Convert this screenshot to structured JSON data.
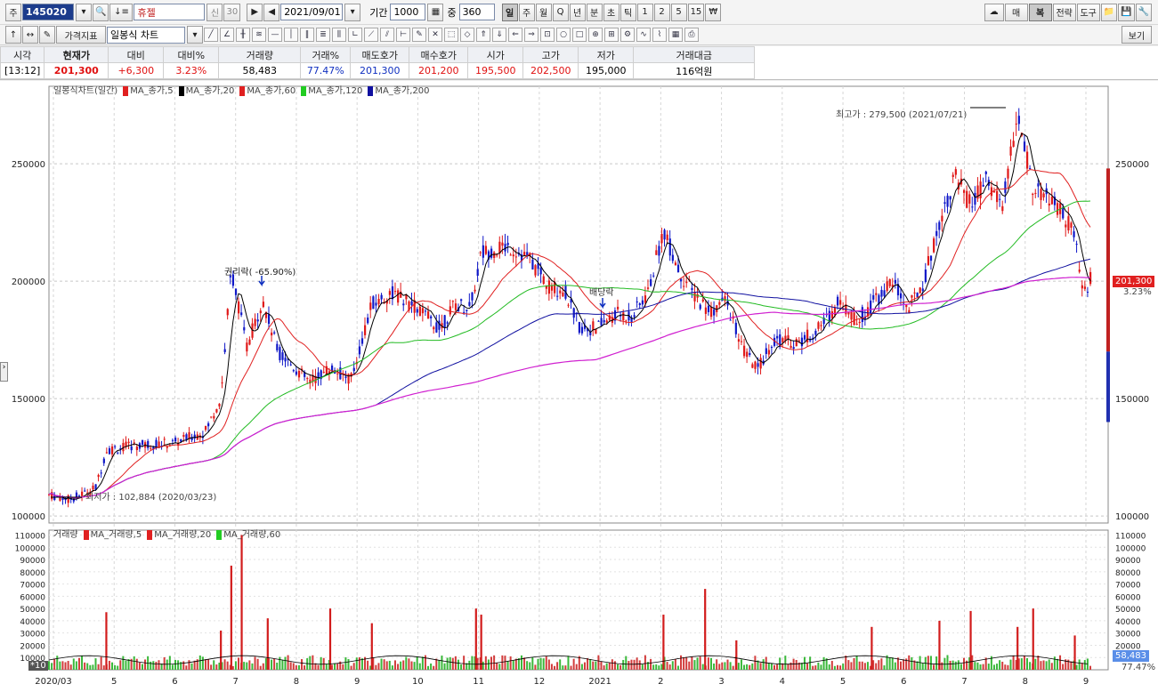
{
  "toolbar1": {
    "market_label": "주",
    "code": "145020",
    "name": "휴젤",
    "credit_tag": "신",
    "credit_value": "30",
    "date": "2021/09/01",
    "period_label": "기간",
    "period_value": "1000",
    "overlap_label": "중",
    "overlap_value": "360",
    "timeframes": [
      "일",
      "주",
      "월",
      "Q",
      "년",
      "분",
      "초",
      "틱",
      "1",
      "2",
      "5",
      "15",
      "₩"
    ],
    "active_timeframe": "일",
    "right_buttons": [
      "매",
      "복",
      "전략",
      "도구"
    ]
  },
  "toolbar2": {
    "indicator_label": "가격지표",
    "chart_type": "일봉식 차트",
    "view_button": "보기"
  },
  "quote": {
    "headers": [
      "시각",
      "현재가",
      "대비",
      "대비%",
      "거래량",
      "거래%",
      "매도호가",
      "매수호가",
      "시가",
      "고가",
      "저가",
      "거래대금"
    ],
    "values": [
      "[13:12]",
      "201,300",
      "+6,300",
      "3.23%",
      "58,483",
      "77.47%",
      "201,300",
      "201,200",
      "195,500",
      "202,500",
      "195,000",
      "116억원"
    ]
  },
  "legend_price": {
    "title": "일봉식차트(일간)",
    "items": [
      {
        "label": "MA_종가,5",
        "color": "#e02020"
      },
      {
        "label": "MA_종가,20",
        "color": "#000000"
      },
      {
        "label": "MA_종가,60",
        "color": "#e02020"
      },
      {
        "label": "MA_종가,120",
        "color": "#22cc22"
      },
      {
        "label": "MA_종가,200",
        "color": "#1010a0"
      }
    ]
  },
  "legend_volume": {
    "title": "거래량",
    "items": [
      {
        "label": "MA_거래량,5",
        "color": "#e02020"
      },
      {
        "label": "MA_거래량,20",
        "color": "#e02020"
      },
      {
        "label": "MA_거래량,60",
        "color": "#22cc22"
      }
    ]
  },
  "annotations": {
    "high": "최고가 : 279,500 (2021/07/21)",
    "low": "최저가 : 102,884 (2020/03/23)",
    "rights": "권리락( -65.90%)",
    "dividend": "배당락"
  },
  "price_badge": {
    "price": "201,300",
    "pct": "3.23%"
  },
  "volume_badge": {
    "volume": "58,483",
    "pct": "77.47%"
  },
  "volume_scale_tag": "*10",
  "chart_data": {
    "type": "candlestick",
    "price_ylim": [
      97000,
      283000
    ],
    "price_ticks": [
      100000,
      150000,
      200000,
      250000
    ],
    "volume_ylim": [
      0,
      114000
    ],
    "volume_ticks": [
      10000,
      20000,
      30000,
      40000,
      50000,
      60000,
      70000,
      80000,
      90000,
      100000,
      110000
    ],
    "x_ticks": [
      "2020/03",
      "5",
      "6",
      "7",
      "8",
      "9",
      "10",
      "11",
      "12",
      "2021",
      "2",
      "3",
      "4",
      "5",
      "6",
      "7",
      "8",
      "9"
    ],
    "anchors": [
      {
        "t": 0.0,
        "p": 109000
      },
      {
        "t": 0.02,
        "p": 107000
      },
      {
        "t": 0.045,
        "p": 112000
      },
      {
        "t": 0.055,
        "p": 128000
      },
      {
        "t": 0.08,
        "p": 130000
      },
      {
        "t": 0.12,
        "p": 131000
      },
      {
        "t": 0.15,
        "p": 136000
      },
      {
        "t": 0.165,
        "p": 150000
      },
      {
        "t": 0.175,
        "p": 205000
      },
      {
        "t": 0.19,
        "p": 172000
      },
      {
        "t": 0.205,
        "p": 192000
      },
      {
        "t": 0.22,
        "p": 170000
      },
      {
        "t": 0.25,
        "p": 157000
      },
      {
        "t": 0.27,
        "p": 163000
      },
      {
        "t": 0.29,
        "p": 158000
      },
      {
        "t": 0.31,
        "p": 190000
      },
      {
        "t": 0.33,
        "p": 195000
      },
      {
        "t": 0.355,
        "p": 188000
      },
      {
        "t": 0.375,
        "p": 180000
      },
      {
        "t": 0.39,
        "p": 190000
      },
      {
        "t": 0.405,
        "p": 189000
      },
      {
        "t": 0.415,
        "p": 212000
      },
      {
        "t": 0.44,
        "p": 215000
      },
      {
        "t": 0.46,
        "p": 210000
      },
      {
        "t": 0.48,
        "p": 198000
      },
      {
        "t": 0.495,
        "p": 196000
      },
      {
        "t": 0.51,
        "p": 180000
      },
      {
        "t": 0.525,
        "p": 180000
      },
      {
        "t": 0.545,
        "p": 186000
      },
      {
        "t": 0.56,
        "p": 185000
      },
      {
        "t": 0.575,
        "p": 195000
      },
      {
        "t": 0.59,
        "p": 222000
      },
      {
        "t": 0.605,
        "p": 204000
      },
      {
        "t": 0.62,
        "p": 194000
      },
      {
        "t": 0.635,
        "p": 187000
      },
      {
        "t": 0.65,
        "p": 192000
      },
      {
        "t": 0.665,
        "p": 172000
      },
      {
        "t": 0.68,
        "p": 162000
      },
      {
        "t": 0.695,
        "p": 175000
      },
      {
        "t": 0.72,
        "p": 174000
      },
      {
        "t": 0.74,
        "p": 180000
      },
      {
        "t": 0.76,
        "p": 192000
      },
      {
        "t": 0.775,
        "p": 183000
      },
      {
        "t": 0.79,
        "p": 190000
      },
      {
        "t": 0.81,
        "p": 200000
      },
      {
        "t": 0.825,
        "p": 188000
      },
      {
        "t": 0.84,
        "p": 200000
      },
      {
        "t": 0.855,
        "p": 225000
      },
      {
        "t": 0.87,
        "p": 245000
      },
      {
        "t": 0.885,
        "p": 232000
      },
      {
        "t": 0.9,
        "p": 243000
      },
      {
        "t": 0.915,
        "p": 232000
      },
      {
        "t": 0.93,
        "p": 270000
      },
      {
        "t": 0.945,
        "p": 240000
      },
      {
        "t": 0.96,
        "p": 235000
      },
      {
        "t": 0.975,
        "p": 228000
      },
      {
        "t": 0.985,
        "p": 218000
      },
      {
        "t": 0.993,
        "p": 194000
      },
      {
        "t": 1.0,
        "p": 201300
      }
    ],
    "volume_spikes": [
      {
        "t": 0.055,
        "v": 47000
      },
      {
        "t": 0.165,
        "v": 32000
      },
      {
        "t": 0.175,
        "v": 85000
      },
      {
        "t": 0.185,
        "v": 110000
      },
      {
        "t": 0.21,
        "v": 42000
      },
      {
        "t": 0.27,
        "v": 50000
      },
      {
        "t": 0.31,
        "v": 38000
      },
      {
        "t": 0.41,
        "v": 50000
      },
      {
        "t": 0.415,
        "v": 45000
      },
      {
        "t": 0.59,
        "v": 45000
      },
      {
        "t": 0.63,
        "v": 66000
      },
      {
        "t": 0.66,
        "v": 24000
      },
      {
        "t": 0.79,
        "v": 35000
      },
      {
        "t": 0.855,
        "v": 40000
      },
      {
        "t": 0.885,
        "v": 48000
      },
      {
        "t": 0.93,
        "v": 35000
      },
      {
        "t": 0.945,
        "v": 50000
      },
      {
        "t": 0.985,
        "v": 28000
      }
    ]
  },
  "colors": {
    "up": "#e01818",
    "down": "#1018c8",
    "grid": "#c8c8c8"
  }
}
